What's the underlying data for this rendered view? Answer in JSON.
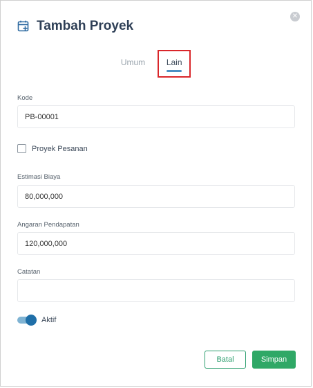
{
  "dialog": {
    "title": "Tambah Proyek",
    "icon": "project-add-icon",
    "close_icon": "close-icon"
  },
  "tabs": [
    {
      "label": "Umum",
      "active": false
    },
    {
      "label": "Lain",
      "active": true
    }
  ],
  "fields": {
    "kode": {
      "label": "Kode",
      "value": "PB-00001"
    },
    "proyek_pesanan": {
      "label": "Proyek Pesanan",
      "checked": false
    },
    "estimasi_biaya": {
      "label": "Estimasi Biaya",
      "value": "80,000,000"
    },
    "anggaran_pendapatan": {
      "label": "Angaran Pendapatan",
      "value": "120,000,000"
    },
    "catatan": {
      "label": "Catatan",
      "value": ""
    },
    "aktif": {
      "label": "Aktif",
      "on": true
    }
  },
  "buttons": {
    "cancel": "Batal",
    "save": "Simpan"
  },
  "colors": {
    "title": "#2e3f56",
    "accent_blue": "#4a90c4",
    "toggle_on": "#1f6fa8",
    "save_green": "#2fa866",
    "highlight_red": "#d9262a"
  }
}
